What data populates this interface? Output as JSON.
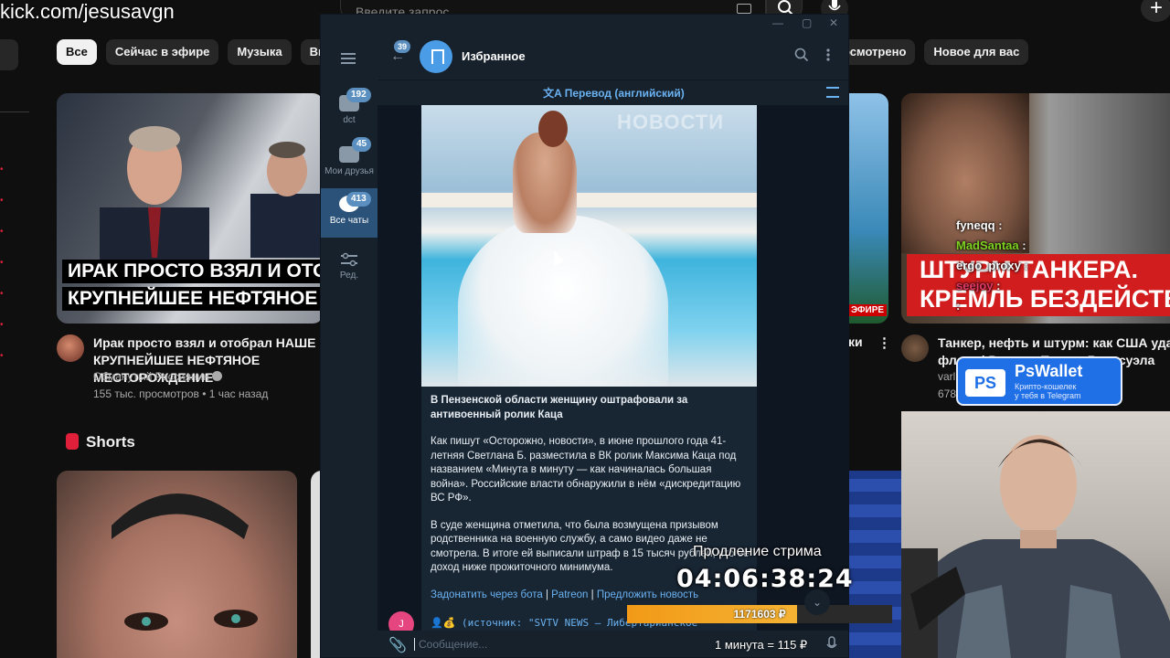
{
  "overlay": {
    "url": "kick.com/jesusavgn",
    "extend_label": "Продление стрима",
    "timer": "04:06:38:24",
    "progress_text": "1171603 ₽",
    "progress_fraction": 0.64,
    "rate": "1 минута = 115 ₽",
    "pswallet": {
      "name": "PsWallet",
      "logo": "PS",
      "sub_line1": "Крипто-кошелек",
      "sub_line2": "у тебя в Telegram"
    },
    "chat": [
      {
        "user": "fyneqq",
        "color": "#ffffff",
        "text": ":"
      },
      {
        "user": "MadSantaa",
        "color": "#7ed321",
        "text": ":"
      },
      {
        "user": "ergo_proxy",
        "color": "#ffffff",
        "text": ":"
      },
      {
        "user": "seejoy",
        "color": "#e23b6a",
        "text": ":"
      },
      {
        "user": "",
        "color": "#ffffff",
        "text": ":"
      }
    ]
  },
  "youtube": {
    "search_placeholder": "Введите запрос",
    "chips": [
      "Все",
      "Сейчас в эфире",
      "Музыка",
      "Видео"
    ],
    "chips_right": [
      "осмотрено",
      "Новое для вас"
    ],
    "video1": {
      "caption_line1": "ИРАК ПРОСТО ВЗЯЛ И ОТОБРАЛ",
      "caption_line2": "КРУПНЕЙШЕЕ НЕФТЯНОЕ МЕСТ",
      "title": "Ирак просто взял и отобрал НАШЕ КРУПНЕЙШЕЕ НЕФТЯНОЕ МЕСТОРОЖДЕНИЕ",
      "channel": "Обманутый Россиянин",
      "meta": "155 тыс. просмотров • 1 час назад"
    },
    "video3": {
      "badge": "ЭФИРЕ",
      "title": "ки",
      "menu": "⋮"
    },
    "video4": {
      "thumb_line1": "ШТУРМ ТАНКЕРА.",
      "thumb_line2": "КРЕМЛЬ БЕЗДЕЙСТВ",
      "title_line1": "Танкер, нефть и штурм: как США удари",
      "title_line2": "флоту | Россия, Трамп, Венесуэла",
      "channel": "varl",
      "meta": "678"
    },
    "shorts_label": "Shorts",
    "plus_icon": "+"
  },
  "telegram": {
    "window_controls": [
      "—",
      "▢",
      "✕"
    ],
    "folders": [
      {
        "label": "dct",
        "badge": "192"
      },
      {
        "label": "Мои друзья",
        "badge": "45"
      },
      {
        "label": "Все чаты",
        "badge": "413"
      },
      {
        "label": "Ред.",
        "badge": ""
      }
    ],
    "back_badge": "39",
    "chat_title": "Избранное",
    "translate": "Перевод (английский)",
    "photo_watermark": "НОВОСТИ",
    "message": {
      "headline": "В Пензенской области женщину оштрафовали за антивоенный ролик Каца",
      "p1": "Как пишут «Осторожно, новости», в июне прошлого года 41-летняя Светлана Б. разместила в ВК ролик Максима Каца под названием «Минута в минуту — как начиналась большая война». Российские власти обнаружили в нём «дискредитацию ВС РФ».",
      "p2": "В суде женщина отметила, что была возмущена призывом родственника на военную службу, а само видео даже не смотрела. В итоге ей выписали штраф в 15 тысяч рублей, что её доход ниже прожиточного минимума.",
      "link1": "Задонатить через бота",
      "link2": "Patreon",
      "link3": "Предложить новость",
      "source": "👤💰 (источник: \"SVTV NEWS — Либертарианское"
    },
    "avatar_letter": "J",
    "compose_placeholder": "Сообщение..."
  }
}
